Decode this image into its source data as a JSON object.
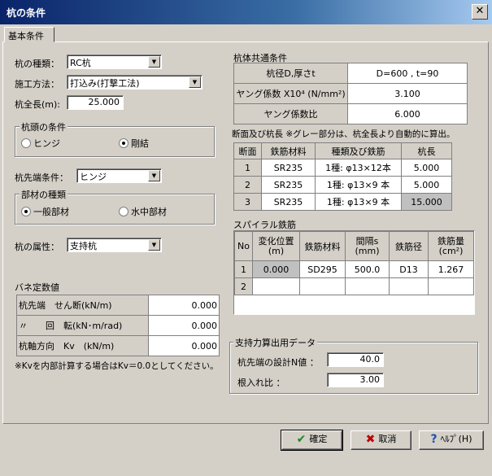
{
  "window": {
    "title": "杭の条件",
    "close_glyph": "✕"
  },
  "tab": {
    "label": "基本条件"
  },
  "pile_type": {
    "label": "杭の種類：",
    "value": "RC杭"
  },
  "construction": {
    "label": "施工方法：",
    "value": "打込み(打撃工法)"
  },
  "length": {
    "label": "杭全長(m):",
    "value": "25.000"
  },
  "head": {
    "title": "杭頭の条件",
    "options": [
      "ヒンジ",
      "剛結"
    ],
    "selected": "剛結"
  },
  "tip": {
    "label": "杭先端条件：",
    "value": "ヒンジ"
  },
  "material": {
    "title": "部材の種類",
    "options": [
      "一般部材",
      "水中部材"
    ],
    "selected": "一般部材"
  },
  "attribute": {
    "label": "杭の属性：",
    "value": "支持杭"
  },
  "spring": {
    "title": "バネ定数値",
    "rows": [
      {
        "label": "杭先端　せん断(kN/m)",
        "value": "0.000"
      },
      {
        "label": "〃　　回　転(kN･m/rad)",
        "value": "0.000"
      },
      {
        "label": "杭軸方向　Kv　(kN/m)",
        "value": "0.000"
      }
    ],
    "note": "※Kvを内部計算する場合はKv＝0.0としてください。"
  },
  "common": {
    "title": "杭体共通条件",
    "rows": [
      {
        "label": "杭径D,厚さt",
        "value": "D=600 , t=90"
      },
      {
        "label": "ヤング係数 X10⁴ (N/mm²)",
        "value": "3.100"
      },
      {
        "label": "ヤング係数比",
        "value": "6.000"
      }
    ]
  },
  "section": {
    "title": "断面及び杭長 ※グレー部分は、杭全長より自動的に算出。",
    "headers": [
      "断面",
      "鉄筋材料",
      "種類及び鉄筋",
      "杭長"
    ],
    "rows": [
      {
        "no": "1",
        "material": "SR235",
        "rebar": "1種: φ13×12本",
        "length": "5.000"
      },
      {
        "no": "2",
        "material": "SR235",
        "rebar": "1種: φ13×9 本",
        "length": "5.000"
      },
      {
        "no": "3",
        "material": "SR235",
        "rebar": "1種: φ13×9 本",
        "length": "15.000"
      }
    ]
  },
  "spiral": {
    "title": "スパイラル鉄筋",
    "headers": [
      "No",
      "変化位置\n(m)",
      "鉄筋材料",
      "間隔s\n(mm)",
      "鉄筋径",
      "鉄筋量\n(cm²)"
    ],
    "rows": [
      {
        "no": "1",
        "pos": "0.000",
        "material": "SD295",
        "pitch": "500.0",
        "dia": "D13",
        "area": "1.267"
      },
      {
        "no": "2",
        "pos": "",
        "material": "",
        "pitch": "",
        "dia": "",
        "area": ""
      }
    ]
  },
  "bearing": {
    "title": "支持力算出用データ",
    "n_label": "杭先端の設計N値 ：",
    "n_value": "40.0",
    "ratio_label": "根入れ比 ：",
    "ratio_value": "3.00"
  },
  "buttons": {
    "ok": "確定",
    "cancel": "取消",
    "help": "ﾍﾙﾌﾟ(H)",
    "ok_icon": "✔",
    "cancel_icon": "✖",
    "help_icon": "?"
  },
  "colors": {
    "title_start": "#0a246a",
    "title_end": "#a6caf0",
    "face": "#d4d0c8",
    "ok_icon": "#1a8a1a",
    "cancel_icon": "#c00000",
    "help_icon": "#1f4fb0"
  }
}
